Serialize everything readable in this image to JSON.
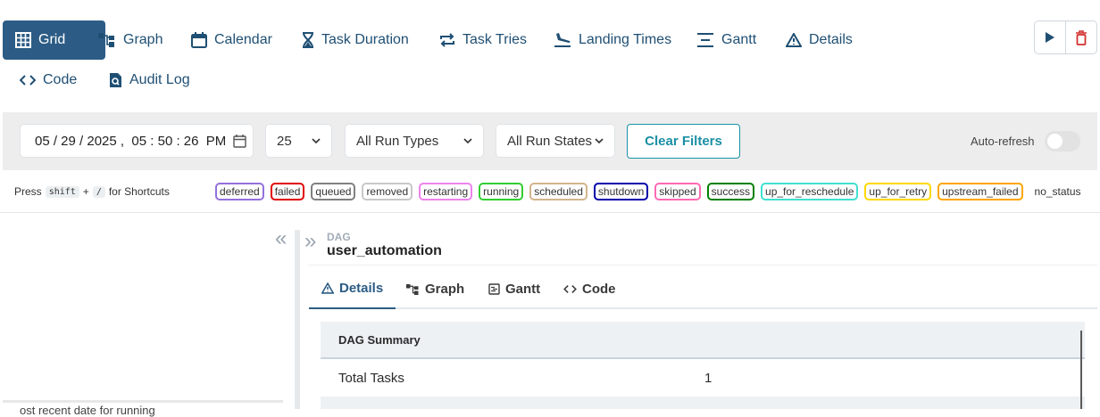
{
  "nav": {
    "grid": "Grid",
    "graph": "Graph",
    "calendar": "Calendar",
    "task_duration": "Task Duration",
    "task_tries": "Task Tries",
    "landing_times": "Landing Times",
    "gantt": "Gantt",
    "details": "Details",
    "code": "Code",
    "audit_log": "Audit Log"
  },
  "filters": {
    "date": "05 / 29 / 2025 ,  05 : 50 : 26  PM",
    "limit": "25",
    "run_types": "All Run Types",
    "run_states": "All Run States",
    "clear": "Clear Filters",
    "auto_refresh": "Auto-refresh"
  },
  "shortcuts": {
    "press": "Press",
    "key1": "shift",
    "plus": "+",
    "key2": "/",
    "suffix": "for Shortcuts"
  },
  "states": [
    {
      "label": "deferred",
      "color": "#9370db"
    },
    {
      "label": "failed",
      "color": "#e00000"
    },
    {
      "label": "queued",
      "color": "#808080"
    },
    {
      "label": "removed",
      "color": "#c8c8c8"
    },
    {
      "label": "restarting",
      "color": "#ee82ee"
    },
    {
      "label": "running",
      "color": "#32cd32"
    },
    {
      "label": "scheduled",
      "color": "#d2b48c"
    },
    {
      "label": "shutdown",
      "color": "#0000aa"
    },
    {
      "label": "skipped",
      "color": "#ff69b4"
    },
    {
      "label": "success",
      "color": "#008000"
    },
    {
      "label": "up_for_reschedule",
      "color": "#40e0d0"
    },
    {
      "label": "up_for_retry",
      "color": "#ffd700"
    },
    {
      "label": "upstream_failed",
      "color": "#ffa500"
    },
    {
      "label": "no_status",
      "color": ""
    }
  ],
  "left": {
    "cut_text": "ost recent date for running"
  },
  "dag": {
    "kind": "DAG",
    "name": "user_automation",
    "tabs": {
      "details": "Details",
      "graph": "Graph",
      "gantt": "Gantt",
      "code": "Code"
    },
    "summary_title": "DAG Summary",
    "rows": [
      {
        "key": "Total Tasks",
        "value": "1"
      }
    ]
  }
}
